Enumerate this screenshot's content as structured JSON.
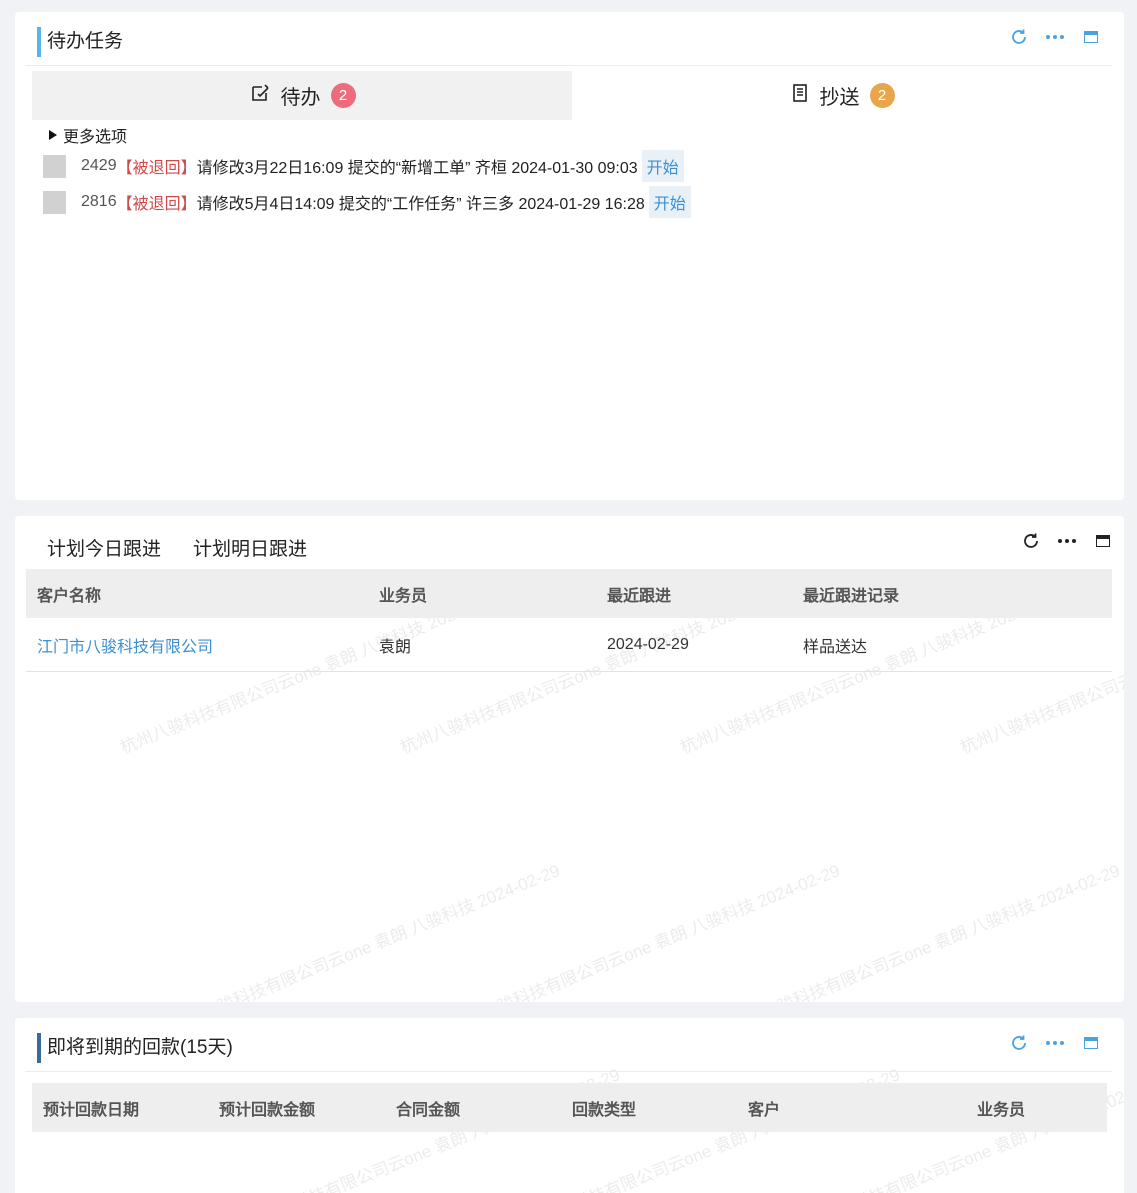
{
  "todo_panel": {
    "title": "待办任务",
    "accent": "#5bb4ea",
    "tabs": [
      {
        "label": "待办",
        "count": "2",
        "badge_color": "#ee6b7b"
      },
      {
        "label": "抄送",
        "count": "2",
        "badge_color": "#e8a54a"
      }
    ],
    "more_options": "更多选项",
    "tasks": [
      {
        "id": "2429",
        "tag": "【被退回】",
        "text": "请修改3月22日16:09 提交的“新增工单” 齐桓 2024-01-30 09:03",
        "action": "开始"
      },
      {
        "id": "2816",
        "tag": "【被退回】",
        "text": "请修改5月4日14:09 提交的“工作任务” 许三多 2024-01-29 16:28",
        "action": "开始"
      }
    ]
  },
  "followup_panel": {
    "tabs": [
      "计划今日跟进",
      "计划明日跟进"
    ],
    "columns": [
      "客户名称",
      "业务员",
      "最近跟进",
      "最近跟进记录"
    ],
    "rows": [
      {
        "customer": "江门市八骏科技有限公司",
        "salesperson": "袁朗",
        "last_followup": "2024-02-29",
        "record": "样品送达"
      }
    ],
    "watermark": "杭州八骏科技有限公司云one 袁朗 八骏科技 2024-02-29"
  },
  "payment_panel": {
    "title": "即将到期的回款(15天)",
    "accent": "#3a6a9a",
    "columns": [
      "预计回款日期",
      "预计回款金额",
      "合同金额",
      "回款类型",
      "客户",
      "业务员"
    ]
  },
  "icons": [
    "refresh-icon",
    "more-icon",
    "maximize-icon",
    "todo-icon",
    "cc-icon"
  ]
}
